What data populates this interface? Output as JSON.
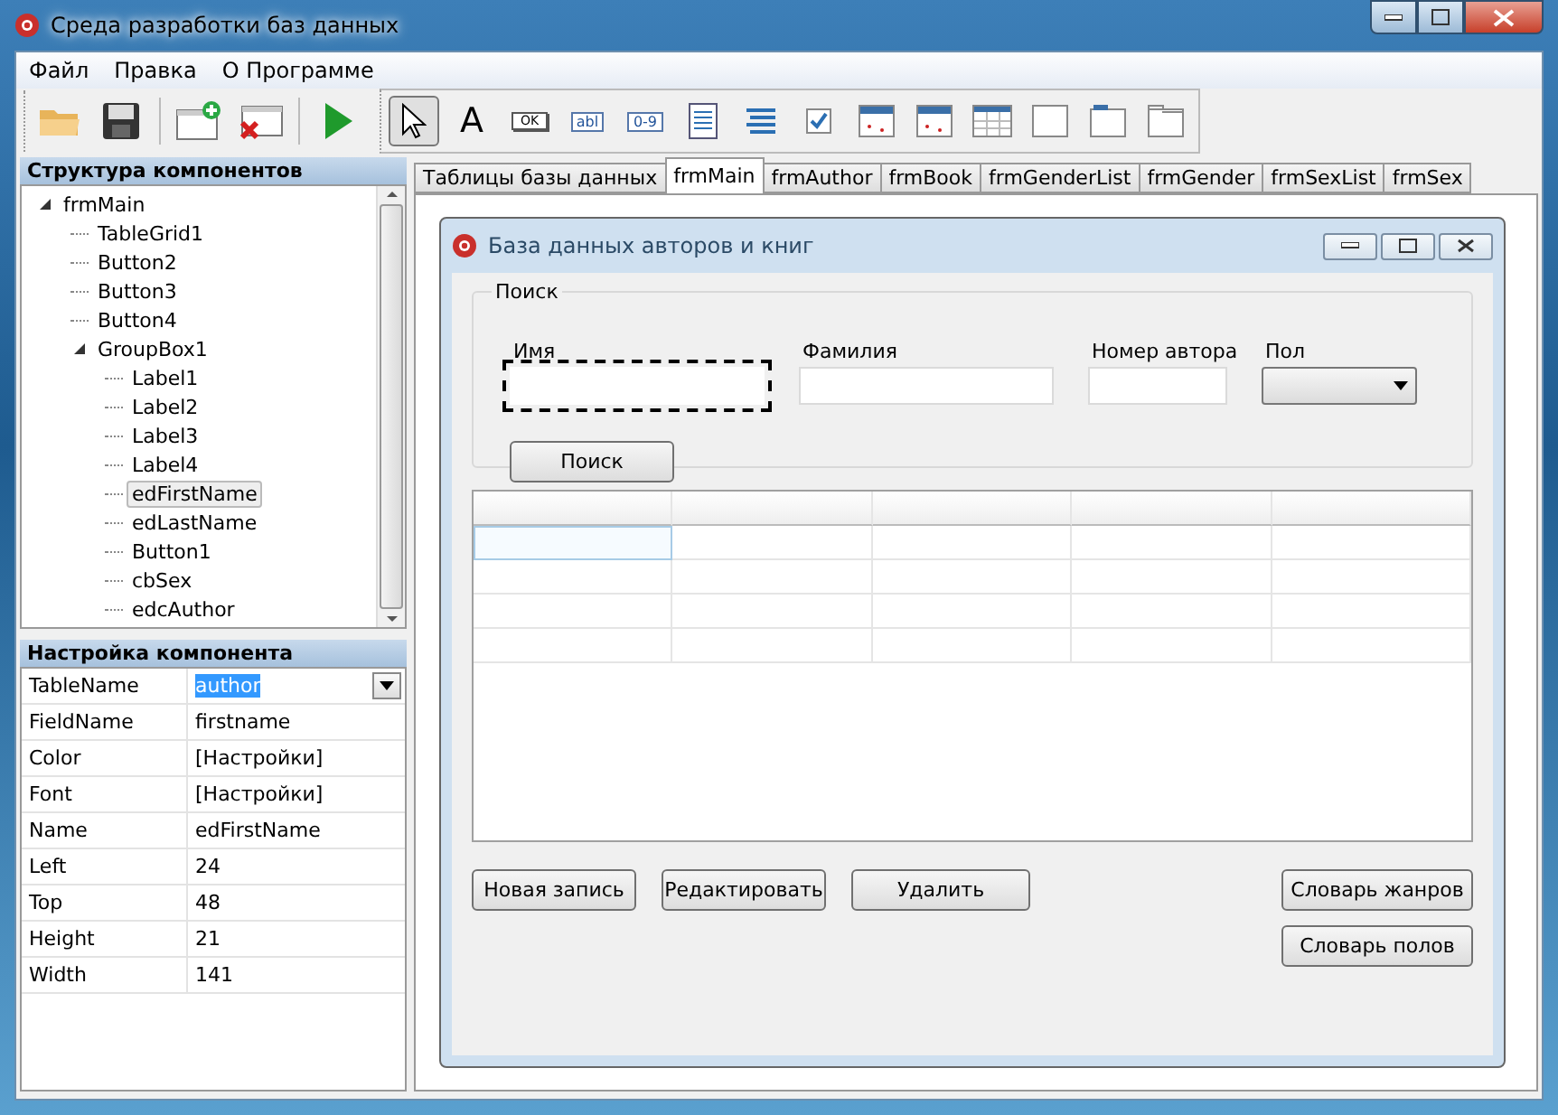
{
  "window": {
    "title": "Среда разработки баз данных"
  },
  "menu": [
    "Файл",
    "Правка",
    "О Программе"
  ],
  "toolbar": {
    "file_tools": [
      {
        "kind": "open"
      },
      {
        "kind": "save"
      },
      {
        "kind": "add-form"
      },
      {
        "kind": "delete-form"
      },
      {
        "kind": "run"
      }
    ],
    "components": [
      {
        "kind": "pointer",
        "selected": true
      },
      {
        "kind": "text",
        "label": "A",
        "selected": false
      },
      {
        "kind": "button",
        "label": "OK",
        "selected": false
      },
      {
        "kind": "edit",
        "label": "abl",
        "selected": false
      },
      {
        "kind": "edit",
        "label": "0-9",
        "selected": false
      },
      {
        "kind": "memo",
        "selected": false
      },
      {
        "kind": "list",
        "selected": false
      },
      {
        "kind": "check",
        "selected": false
      },
      {
        "kind": "form-a",
        "selected": false
      },
      {
        "kind": "form-b",
        "selected": false
      },
      {
        "kind": "grid",
        "selected": false
      },
      {
        "kind": "panel",
        "selected": false
      },
      {
        "kind": "tab-panel",
        "selected": false
      },
      {
        "kind": "page",
        "selected": false
      }
    ]
  },
  "structure": {
    "title": "Структура компонентов",
    "tree": [
      {
        "label": "frmMain",
        "selected": false,
        "expanded": true,
        "children": [
          {
            "label": "TableGrid1",
            "selected": false
          },
          {
            "label": "Button2",
            "selected": false
          },
          {
            "label": "Button3",
            "selected": false
          },
          {
            "label": "Button4",
            "selected": false
          },
          {
            "label": "GroupBox1",
            "selected": false,
            "expanded": true,
            "children": [
              {
                "label": "Label1",
                "selected": false
              },
              {
                "label": "Label2",
                "selected": false
              },
              {
                "label": "Label3",
                "selected": false
              },
              {
                "label": "Label4",
                "selected": false
              },
              {
                "label": "edFirstName",
                "selected": true
              },
              {
                "label": "edLastName",
                "selected": false
              },
              {
                "label": "Button1",
                "selected": false
              },
              {
                "label": "cbSex",
                "selected": false
              },
              {
                "label": "edcAuthor",
                "selected": false
              }
            ]
          }
        ]
      }
    ]
  },
  "properties": {
    "title": "Настройка компонента",
    "rows": [
      {
        "name": "TableName",
        "value": "author",
        "kind": "dropdown"
      },
      {
        "name": "FieldName",
        "value": "firstname",
        "kind": "text"
      },
      {
        "name": "Color",
        "value": "[Настройки]",
        "kind": "text"
      },
      {
        "name": "Font",
        "value": "[Настройки]",
        "kind": "text"
      },
      {
        "name": "Name",
        "value": "edFirstName",
        "kind": "text"
      },
      {
        "name": "Left",
        "value": "24",
        "kind": "text"
      },
      {
        "name": "Top",
        "value": "48",
        "kind": "text"
      },
      {
        "name": "Height",
        "value": "21",
        "kind": "text"
      },
      {
        "name": "Width",
        "value": "141",
        "kind": "text"
      }
    ]
  },
  "tabs": [
    {
      "label": "Таблицы базы данных",
      "selected": false
    },
    {
      "label": "frmMain",
      "selected": true
    },
    {
      "label": "frmAuthor",
      "selected": false
    },
    {
      "label": "frmBook",
      "selected": false
    },
    {
      "label": "frmGenderList",
      "selected": false
    },
    {
      "label": "frmGender",
      "selected": false
    },
    {
      "label": "frmSexList",
      "selected": false
    },
    {
      "label": "frmSex",
      "selected": false
    }
  ],
  "form": {
    "title": "База данных авторов и книг",
    "search_group": {
      "title": "Поиск",
      "fields": [
        {
          "label": "Имя",
          "kind": "edit",
          "selected": true
        },
        {
          "label": "Фамилия",
          "kind": "edit",
          "selected": false
        },
        {
          "label": "Номер автора",
          "kind": "edit",
          "selected": false
        },
        {
          "label": "Пол",
          "kind": "combo",
          "selected": false
        }
      ],
      "button": "Поиск"
    },
    "buttons_left": [
      "Новая запись",
      "Редактировать",
      "Удалить"
    ],
    "buttons_right": [
      "Словарь жанров",
      "Словарь полов"
    ]
  }
}
